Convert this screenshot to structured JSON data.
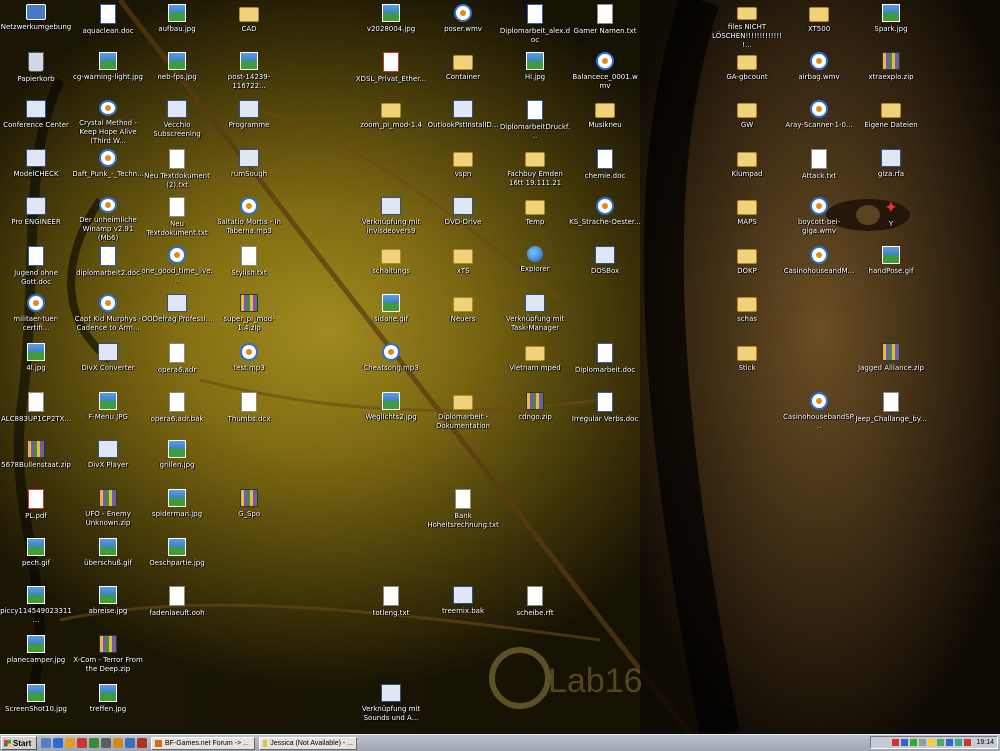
{
  "desktop": {
    "wallpaper": {
      "brand": "Lab16"
    },
    "icons": [
      {
        "label": "Netzwerkumgebung",
        "type": "pc"
      },
      {
        "label": "aquaclean.doc",
        "type": "doc"
      },
      {
        "label": "aufbau.jpg",
        "type": "img"
      },
      {
        "label": "CAD",
        "type": "folder"
      },
      {
        "label": "v2028004.jpg",
        "type": "img"
      },
      {
        "label": "poser.wmv",
        "type": "media"
      },
      {
        "label": "Diplomarbeit_alex.doc",
        "type": "doc"
      },
      {
        "label": "Gamer Namen.txt",
        "type": "txt"
      },
      {
        "label": "files NICHT LÖSCHEN!!!!!!!!!!!!!!...",
        "type": "folder"
      },
      {
        "label": "XT500",
        "type": "folder"
      },
      {
        "label": "Spark.jpg",
        "type": "img"
      },
      {
        "label": "Papierkorb",
        "type": "bin"
      },
      {
        "label": "cg-warning-light.jpg",
        "type": "img"
      },
      {
        "label": "neb-fps.jpg",
        "type": "img"
      },
      {
        "label": "post-14239-116722...",
        "type": "img"
      },
      {
        "label": "XDSL_Privat_Ether...",
        "type": "pdf"
      },
      {
        "label": "Container",
        "type": "folder"
      },
      {
        "label": "Hi.jpg",
        "type": "img"
      },
      {
        "label": "Balancece_0001.wmv",
        "type": "media"
      },
      {
        "label": "GA-gbcount",
        "type": "folder"
      },
      {
        "label": "airbag.wmv",
        "type": "media"
      },
      {
        "label": "xtraexplo.zip",
        "type": "zip"
      },
      {
        "label": "Conference Center",
        "type": "app"
      },
      {
        "label": "Crystal Method - Keep Hope Alive (Third W...",
        "type": "media"
      },
      {
        "label": "Vecchio Subscreening",
        "type": "app"
      },
      {
        "label": "Programme",
        "type": "app"
      },
      {
        "label": "zoom_pi_mod-1.4",
        "type": "folder"
      },
      {
        "label": "OutlookPstInstallD...",
        "type": "app"
      },
      {
        "label": "DiplomarbeitDruckf...",
        "type": "doc"
      },
      {
        "label": "Musikneu",
        "type": "folder"
      },
      {
        "label": "GW",
        "type": "folder"
      },
      {
        "label": "Aray-Scanner-1-0...",
        "type": "media"
      },
      {
        "label": "Eigene Dateien",
        "type": "folder"
      },
      {
        "label": "ModelCHECK",
        "type": "app"
      },
      {
        "label": "Daft_Punk_-_Techn...",
        "type": "media"
      },
      {
        "label": "Neu Textdokument (2).txt",
        "type": "txt"
      },
      {
        "label": "rumSough",
        "type": "app"
      },
      {
        "label": "vspn",
        "type": "folder"
      },
      {
        "label": "Fachbuy Emden 16tt 19.111.21",
        "type": "folder"
      },
      {
        "label": "chemie.doc",
        "type": "doc"
      },
      {
        "label": "Klumpad",
        "type": "folder"
      },
      {
        "label": "Attack.txt",
        "type": "txt"
      },
      {
        "label": "giza.rfa",
        "type": "app"
      },
      {
        "label": "Pro ENGINEER",
        "type": "app"
      },
      {
        "label": "Der unheimliche Winamp v2.91 (Mb6)",
        "type": "media"
      },
      {
        "label": "Neu Textdokument.txt",
        "type": "txt"
      },
      {
        "label": "Saltatio Mortis - In Taberna.mp3",
        "type": "media"
      },
      {
        "label": "Verknüpfung mit invisdeovers9",
        "type": "app"
      },
      {
        "label": "DVD-Drive",
        "type": "app"
      },
      {
        "label": "Temp",
        "type": "folder"
      },
      {
        "label": "KS_Strache-Oester...",
        "type": "media"
      },
      {
        "label": "MAPS",
        "type": "folder"
      },
      {
        "label": "boycott-bei-giga.wmv",
        "type": "media"
      },
      {
        "label": "Y",
        "type": "red"
      },
      {
        "label": "Jugend ohne Gott.doc",
        "type": "doc"
      },
      {
        "label": "diplomarbeit2.doc",
        "type": "doc"
      },
      {
        "label": "one_good_time_live...",
        "type": "media"
      },
      {
        "label": "Stylish.txt",
        "type": "txt"
      },
      {
        "label": "schaltungs",
        "type": "folder"
      },
      {
        "label": "xTS",
        "type": "folder"
      },
      {
        "label": "Explorer",
        "type": "globe"
      },
      {
        "label": "DOSBox",
        "type": "app"
      },
      {
        "label": "DOKP",
        "type": "folder"
      },
      {
        "label": "CasinohouseandM...",
        "type": "media"
      },
      {
        "label": "handPose.gif",
        "type": "img"
      },
      {
        "label": "militaer-tuer-certifi...",
        "type": "media"
      },
      {
        "label": "Capt Kid Murphys - Cadence to Arm...",
        "type": "media"
      },
      {
        "label": "OODefrag Professi...",
        "type": "app"
      },
      {
        "label": "super_pi_mod-1.4.zip",
        "type": "zip"
      },
      {
        "label": "sidane.gif",
        "type": "img"
      },
      {
        "label": "Neuers",
        "type": "folder"
      },
      {
        "label": "Verknüpfung mit Task-Manager",
        "type": "app"
      },
      {
        "label": "schas",
        "type": "folder"
      },
      {
        "label": "4l.jpg",
        "type": "img"
      },
      {
        "label": "DivX Converter",
        "type": "app"
      },
      {
        "label": "opera6.adr",
        "type": "txt"
      },
      {
        "label": "test.mp3",
        "type": "media"
      },
      {
        "label": "Cheatsong.mp3",
        "type": "media"
      },
      {
        "label": "Vietnam mped",
        "type": "folder"
      },
      {
        "label": "Diplomarbeit.doc",
        "type": "doc"
      },
      {
        "label": "Stick",
        "type": "folder"
      },
      {
        "label": "Jagged Alliance.zip",
        "type": "zip"
      },
      {
        "label": "ALC883UP1CP2TX...",
        "type": "txt"
      },
      {
        "label": "F-Menu.JPG",
        "type": "img"
      },
      {
        "label": "opera6.adr.bak",
        "type": "txt"
      },
      {
        "label": "Thumbs.dcx",
        "type": "txt"
      },
      {
        "label": "Weglichts2.jpg",
        "type": "img"
      },
      {
        "label": "Diplomarbeit - Dokumentation",
        "type": "folder"
      },
      {
        "label": "cdngo.zip",
        "type": "zip"
      },
      {
        "label": "Irregular Verbs.doc",
        "type": "doc"
      },
      {
        "label": "CasinohousebandSP...",
        "type": "media"
      },
      {
        "label": "Jeep_Challange_by...",
        "type": "txt"
      },
      {
        "label": "5678Bullenstaat.zip",
        "type": "zip"
      },
      {
        "label": "DivX Player",
        "type": "app"
      },
      {
        "label": "grillen.jpg",
        "type": "img"
      },
      {
        "label": "PL.pdf",
        "type": "pdf"
      },
      {
        "label": "UFO - Enemy Unknown.zip",
        "type": "zip"
      },
      {
        "label": "spiderman.jpg",
        "type": "img"
      },
      {
        "label": "G_Spo",
        "type": "zip"
      },
      {
        "label": "Bank Hoheitsrechnung.txt",
        "type": "txt"
      },
      {
        "label": "pech.gif",
        "type": "img"
      },
      {
        "label": "überschuß.gif",
        "type": "img"
      },
      {
        "label": "Oeschpartie.jpg",
        "type": "img"
      },
      {
        "label": "piccy114549023311...",
        "type": "img"
      },
      {
        "label": "abreise.jpg",
        "type": "img"
      },
      {
        "label": "fadenlaeuft.ooh",
        "type": "txt"
      },
      {
        "label": "totleng.txt",
        "type": "txt"
      },
      {
        "label": "treemix.bak",
        "type": "app"
      },
      {
        "label": "scheibe.rft",
        "type": "txt"
      },
      {
        "label": "planecamper.jpg",
        "type": "img"
      },
      {
        "label": "X-Com - Terror From the Deep.zip",
        "type": "zip"
      },
      {
        "label": "ScreenShot10.jpg",
        "type": "img"
      },
      {
        "label": "treffen.jpg",
        "type": "img"
      },
      {
        "label": "Verknüpfung mit Sounds und A...",
        "type": "app"
      }
    ]
  },
  "taskbar": {
    "start_label": "Start",
    "tasks": [
      {
        "label": "BF-Games.net Forum -> ..."
      },
      {
        "label": "Jessica (Not Available) - ..."
      }
    ],
    "clock": "19:14"
  }
}
